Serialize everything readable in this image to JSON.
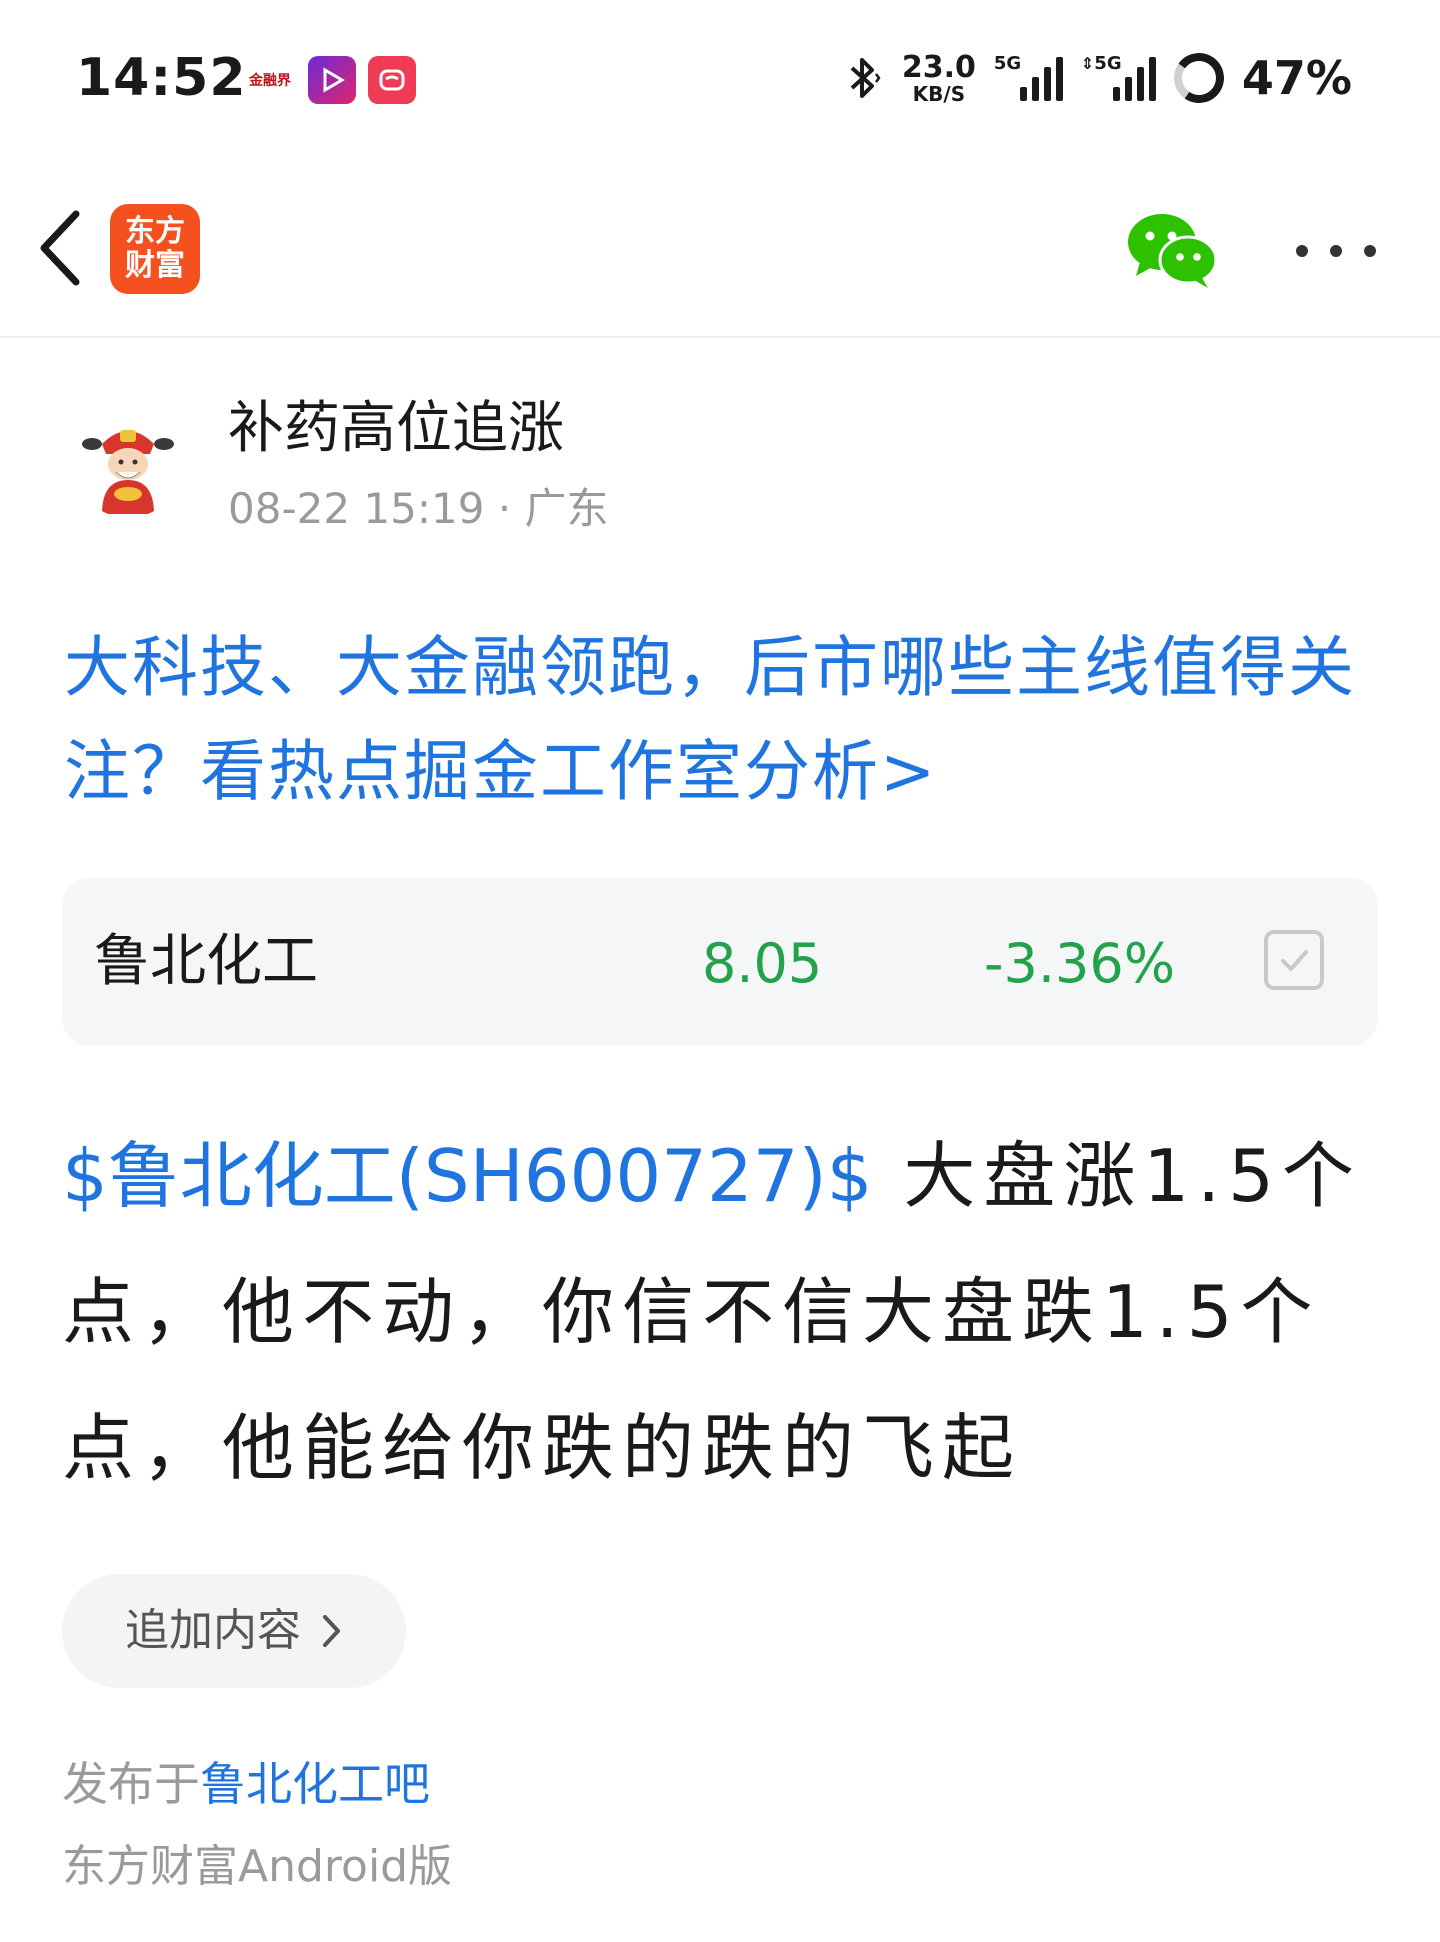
{
  "status_bar": {
    "time": "14:52",
    "notifications": [
      "金融界",
      "video-app",
      "xf-app"
    ],
    "net_speed_value": "23.0",
    "net_speed_unit": "KB/S",
    "signal1_tag": "5G",
    "signal2_tag": "5G",
    "battery": "47%"
  },
  "header": {
    "back_icon": "chevron-left-icon",
    "brand_line1": "东方",
    "brand_line2": "财富",
    "share_icon": "wechat-icon",
    "more_icon": "more-dots-icon"
  },
  "author": {
    "name": "补药高位追涨",
    "meta": "08-22 15:19 · 广东"
  },
  "promo": {
    "text": "大科技、大金融领跑，后市哪些主线值得关注？看热点掘金工作室分析>"
  },
  "stock": {
    "name": "鲁北化工",
    "price": "8.05",
    "change": "-3.36%",
    "price_color": "#22a24a"
  },
  "post": {
    "stock_tag": "$鲁北化工(SH600727)$",
    "text": " 大盘涨1.5个点，他不动，你信不信大盘跌1.5个点，他能给你跌的跌的飞起"
  },
  "add_content": {
    "label": "追加内容"
  },
  "footer": {
    "published_prefix": "发布于",
    "forum": "鲁北化工吧",
    "client": "东方财富Android版"
  },
  "colors": {
    "link": "#1f74e0",
    "brand": "#f5511e",
    "down": "#22a24a",
    "meta": "#9a9a9a"
  }
}
